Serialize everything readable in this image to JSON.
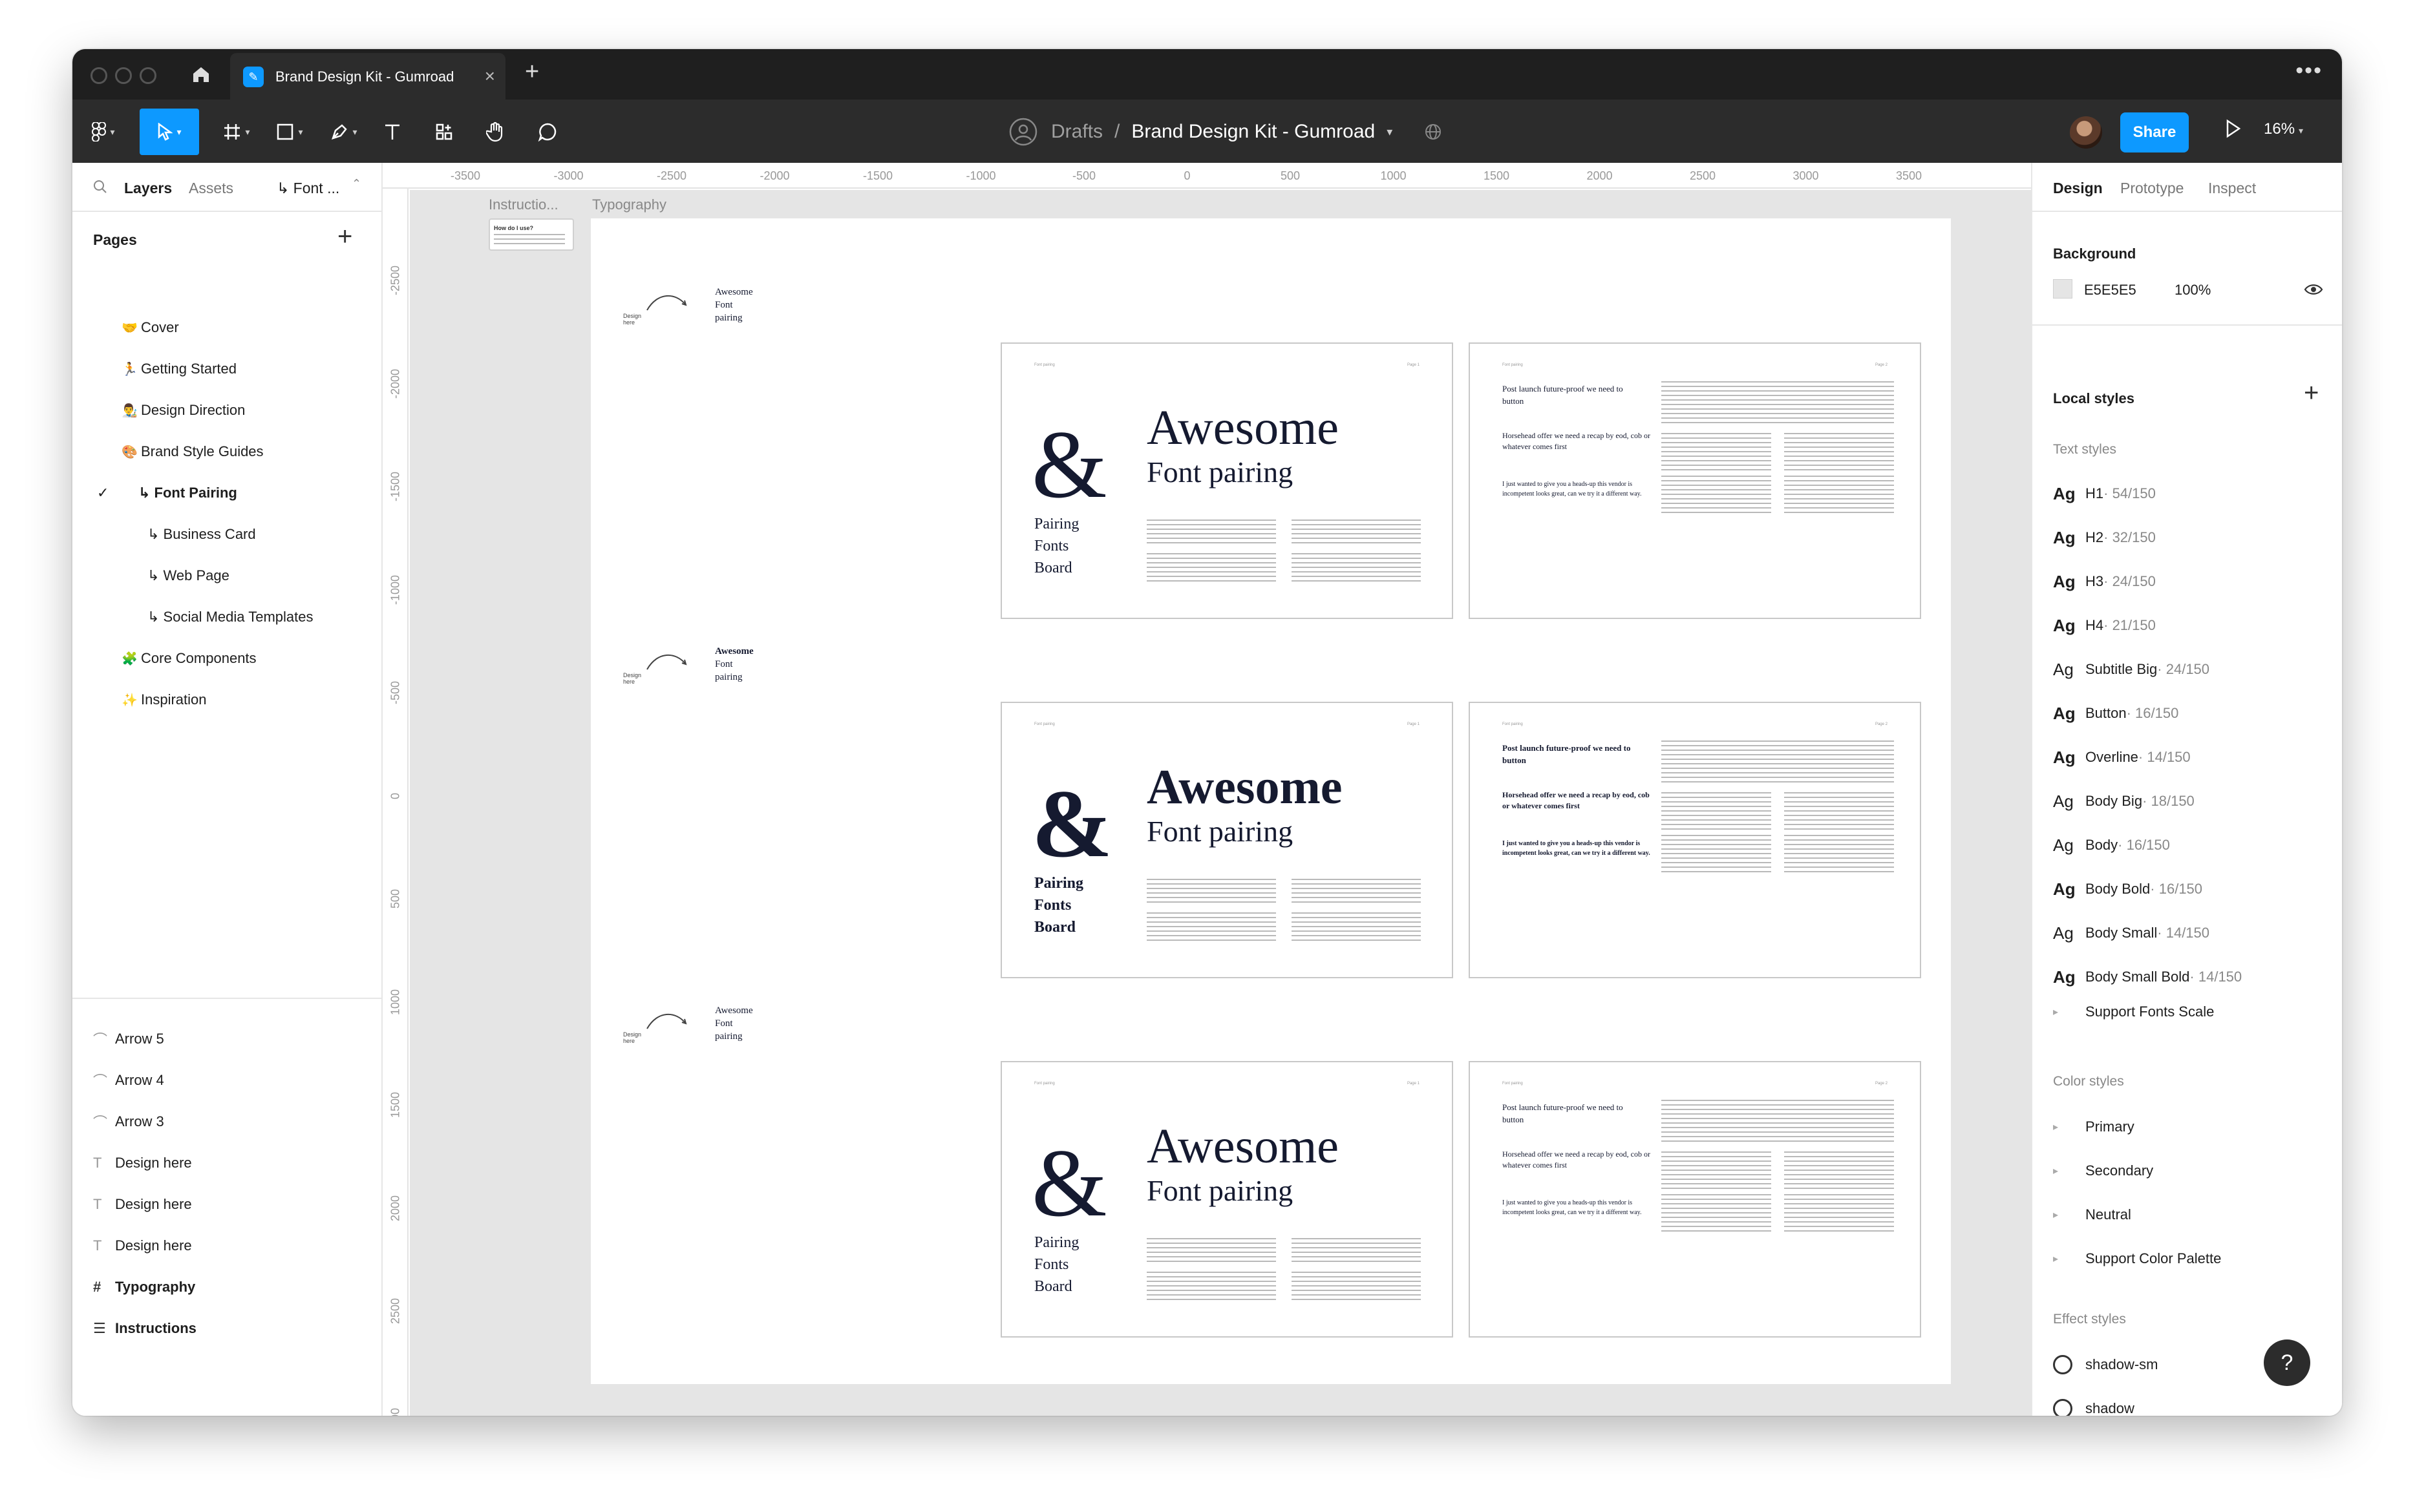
{
  "tabbar": {
    "tab_title": "Brand Design Kit - Gumroad",
    "close": "×",
    "new_tab": "+",
    "more": "•••"
  },
  "toolbar": {
    "crumb_root": "Drafts",
    "crumb_sep": "/",
    "file_name": "Brand Design Kit - Gumroad",
    "share": "Share",
    "zoom": "16%"
  },
  "left": {
    "tab_layers": "Layers",
    "tab_assets": "Assets",
    "page_selector": "↳ Font ...",
    "pages_title": "Pages",
    "pages": [
      {
        "emoji": "🤝",
        "label": "Cover"
      },
      {
        "emoji": "🏃",
        "label": "Getting Started"
      },
      {
        "emoji": "👨‍🎨",
        "label": "Design Direction"
      },
      {
        "emoji": "🎨",
        "label": "Brand Style Guides"
      },
      {
        "emoji": "",
        "label": "↳ Font Pairing"
      },
      {
        "emoji": "",
        "label": "↳ Business Card"
      },
      {
        "emoji": "",
        "label": "↳ Web Page"
      },
      {
        "emoji": "",
        "label": "↳ Social Media Templates"
      },
      {
        "emoji": "🧩",
        "label": "Core Components"
      },
      {
        "emoji": "✨",
        "label": "Inspiration"
      }
    ],
    "layers": [
      {
        "icon": "⌒",
        "label": "Arrow 5"
      },
      {
        "icon": "⌒",
        "label": "Arrow 4"
      },
      {
        "icon": "⌒",
        "label": "Arrow 3"
      },
      {
        "icon": "T",
        "label": "Design here"
      },
      {
        "icon": "T",
        "label": "Design here"
      },
      {
        "icon": "T",
        "label": "Design here"
      },
      {
        "icon": "#",
        "label": "Typography"
      },
      {
        "icon": "☰",
        "label": "Instructions"
      }
    ]
  },
  "right": {
    "tab_design": "Design",
    "tab_prototype": "Prototype",
    "tab_inspect": "Inspect",
    "background_title": "Background",
    "bg_hex": "E5E5E5",
    "bg_opacity": "100%",
    "bg_color": "#e5e5e5",
    "local_styles": "Local styles",
    "text_styles_title": "Text styles",
    "text_styles": [
      {
        "ag": "Ag",
        "name": "H1",
        "size": " · 54/150"
      },
      {
        "ag": "Ag",
        "name": "H2",
        "size": " · 32/150"
      },
      {
        "ag": "Ag",
        "name": "H3",
        "size": " · 24/150"
      },
      {
        "ag": "Ag",
        "name": "H4",
        "size": " · 21/150"
      },
      {
        "ag": "Ag",
        "name": "Subtitle Big",
        "size": " · 24/150"
      },
      {
        "ag": "Ag",
        "name": "Button",
        "size": " · 16/150"
      },
      {
        "ag": "Ag",
        "name": "Overline",
        "size": " · 14/150"
      },
      {
        "ag": "Ag",
        "name": "Body Big",
        "size": " · 18/150"
      },
      {
        "ag": "Ag",
        "name": "Body",
        "size": " · 16/150"
      },
      {
        "ag": "Ag",
        "name": "Body Bold",
        "size": " · 16/150"
      },
      {
        "ag": "Ag",
        "name": "Body Small",
        "size": " · 14/150"
      },
      {
        "ag": "Ag",
        "name": "Body Small Bold",
        "size": " · 14/150"
      }
    ],
    "support_fonts": "Support Fonts Scale",
    "color_styles_title": "Color styles",
    "color_styles": [
      "Primary",
      "Secondary",
      "Neutral",
      "Support Color Palette"
    ],
    "effect_styles_title": "Effect styles",
    "effect_styles": [
      "shadow-sm",
      "shadow",
      "shadow-md"
    ],
    "help": "?"
  },
  "rulers": {
    "h": [
      "-3500",
      "-3000",
      "-2500",
      "-2000",
      "-1500",
      "-1000",
      "-500",
      "0",
      "500",
      "1000",
      "1500",
      "2000",
      "2500",
      "3000",
      "3500"
    ],
    "v": [
      "-2500",
      "-2000",
      "-1500",
      "-1000",
      "-500",
      "0",
      "500",
      "1000",
      "1500",
      "2000",
      "2500",
      "00"
    ]
  },
  "canvas": {
    "frame_instructions": "Instructio...",
    "frame_typography": "Typography",
    "how_do_i_use": "How do I use?",
    "design_here": "Design here",
    "row_awesome": "Awesome",
    "row_font_pairing": "Font pairing",
    "amp": "&",
    "awesome": "Awesome",
    "font_pairing": "Font pairing",
    "pfb": [
      "Pairing",
      "Fonts",
      "Board"
    ],
    "page1": "Page 1",
    "page2": "Page 2",
    "label_tl": "Font pairing",
    "p2_head1": "Post launch future-proof we need to button",
    "p2_head2": "Horsehead offer we need a recap by eod, cob or whatever comes first",
    "p2_head3": "I just wanted to give you a heads-up this vendor is incompetent looks great, can we try it a different way."
  }
}
